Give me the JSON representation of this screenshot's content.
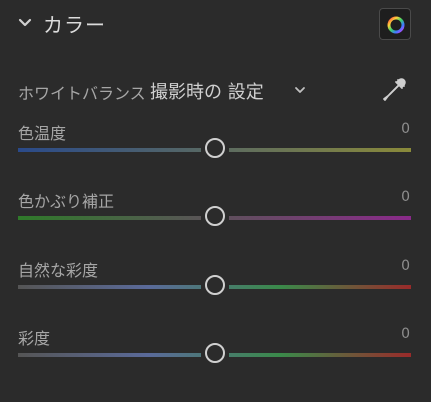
{
  "section": {
    "title": "カラー",
    "collapse_icon": "chevron-down-icon",
    "mixer_icon": "color-wheel-icon"
  },
  "white_balance": {
    "label": "ホワイトバランス",
    "value": "撮影時の 設定",
    "dropdown_icon": "chevron-down-icon",
    "picker_icon": "eyedropper-icon"
  },
  "sliders": [
    {
      "label": "色温度",
      "value": "0",
      "position": 0.5,
      "gradient": [
        "#2a4a8a",
        "#8a8a3a"
      ]
    },
    {
      "label": "色かぶり補正",
      "value": "0",
      "position": 0.5,
      "gradient": [
        "#2f7a2a",
        "#8a2a8a"
      ]
    },
    {
      "label": "自然な彩度",
      "value": "0",
      "position": 0.5,
      "gradient": [
        "#555555",
        "#5a6a9a",
        "#3a8a4a",
        "#9a2a2a"
      ]
    },
    {
      "label": "彩度",
      "value": "0",
      "position": 0.5,
      "gradient": [
        "#555555",
        "#5a6a9a",
        "#3a8a4a",
        "#9a2a2a"
      ]
    }
  ]
}
